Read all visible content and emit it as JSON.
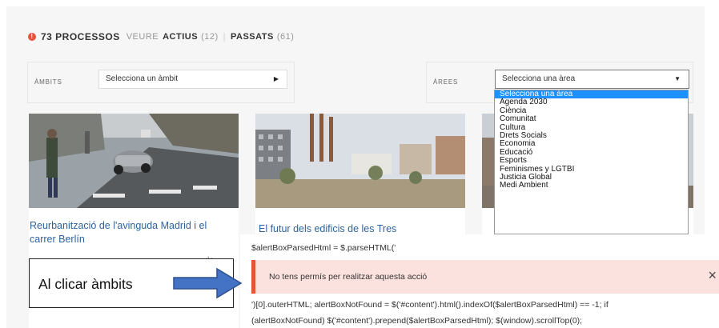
{
  "header": {
    "count_label": "73 PROCESSOS",
    "veure_label": "VEURE",
    "actius_label": "ACTIUS",
    "actius_count": "(12)",
    "passats_label": "PASSATS",
    "passats_count": "(61)"
  },
  "filters": {
    "ambits": {
      "label": "ÀMBITS",
      "value": "Selecciona un àmbit"
    },
    "arees": {
      "label": "ÀREES",
      "value": "Selecciona una àrea"
    }
  },
  "arees_options": [
    "Selecciona una àrea",
    "Agenda 2030",
    "Ciència",
    "Comunitat",
    "Cultura",
    "Drets Socials",
    "Economia",
    "Educació",
    "Esports",
    "Feminismes y LGTBI",
    "Justicia Global",
    "Medi Ambient"
  ],
  "cards": [
    {
      "title": "Reurbanització de l'avinguda Madrid i el carrer Berlín",
      "text_fragment": "de"
    },
    {
      "title": "El futur dels edificis de les Tres"
    }
  ],
  "code": {
    "line1": "$alertBoxParsedHtml = $.parseHTML('",
    "line2": "')[0].outerHTML; alertBoxNotFound = $('#content').html().indexOf($alertBoxParsedHtml) == -1; if",
    "line3": "(alertBoxNotFound) $('#content').prepend($alertBoxParsedHtml); $(window).scrollTop(0);"
  },
  "alert": {
    "message": "No tens permís per realitzar aquesta acció",
    "close": "×"
  },
  "callout": {
    "text": "Al clicar àmbits"
  },
  "colors": {
    "accent_red": "#e5533d",
    "link_blue": "#2d64a0",
    "selected_blue": "#1e90ff",
    "alert_bg": "#fce2de"
  }
}
